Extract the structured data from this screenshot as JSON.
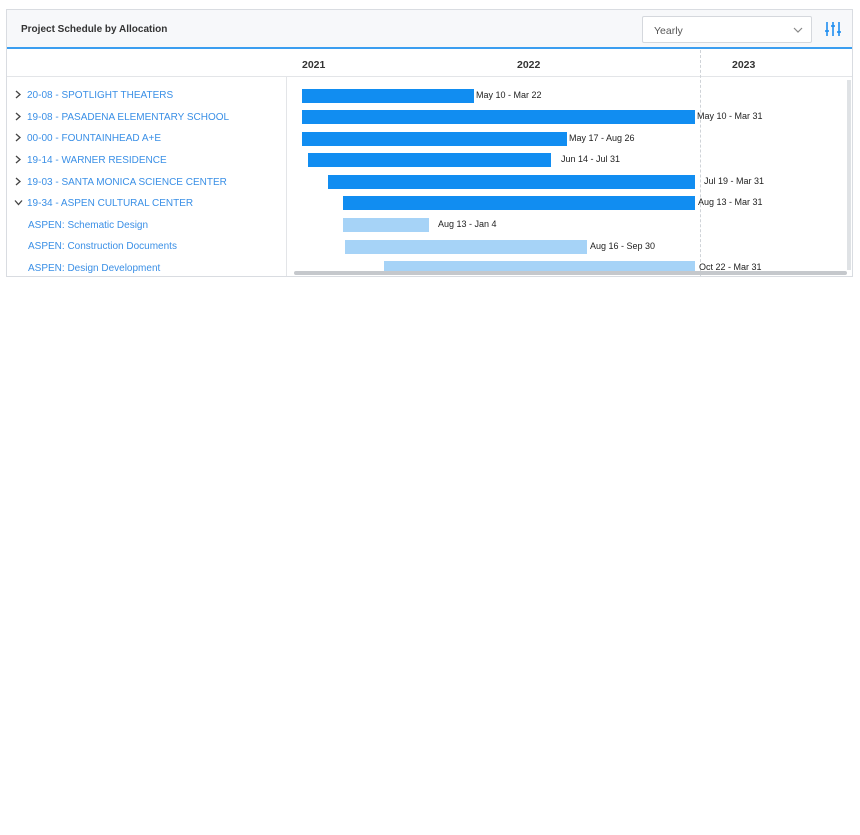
{
  "header": {
    "title": "Project Schedule by Allocation",
    "view_select": "Yearly"
  },
  "timeline": {
    "years": [
      "2021",
      "2022",
      "2023"
    ]
  },
  "rows": [
    {
      "label": "20-08 - SPOTLIGHT THEATERS",
      "dates": "May 10 - Mar 22",
      "state": "collapsed"
    },
    {
      "label": "19-08 - PASADENA ELEMENTARY SCHOOL",
      "dates": "May 10 - Mar 31",
      "state": "collapsed"
    },
    {
      "label": "00-00 - FOUNTAINHEAD A+E",
      "dates": "May 17 - Aug 26",
      "state": "collapsed"
    },
    {
      "label": "19-14 - WARNER RESIDENCE",
      "dates": "Jun 14 - Jul 31",
      "state": "collapsed"
    },
    {
      "label": "19-03 - SANTA MONICA SCIENCE CENTER",
      "dates": "Jul 19 - Mar 31",
      "state": "collapsed"
    },
    {
      "label": "19-34 - ASPEN CULTURAL CENTER",
      "dates": "Aug 13 - Mar 31",
      "state": "expanded"
    },
    {
      "label": "ASPEN: Schematic Design",
      "dates": "Aug 13 - Jan 4",
      "state": "child"
    },
    {
      "label": "ASPEN: Construction Documents",
      "dates": "Aug 16 - Sep 30",
      "state": "child"
    },
    {
      "label": "ASPEN: Design Development",
      "dates": "Oct 22 - Mar 31",
      "state": "child"
    }
  ],
  "colors": {
    "accent": "#3b9ef0",
    "bar_primary": "#118df1",
    "bar_secondary": "#a6d3f7",
    "link_text": "#3a8fe6"
  }
}
